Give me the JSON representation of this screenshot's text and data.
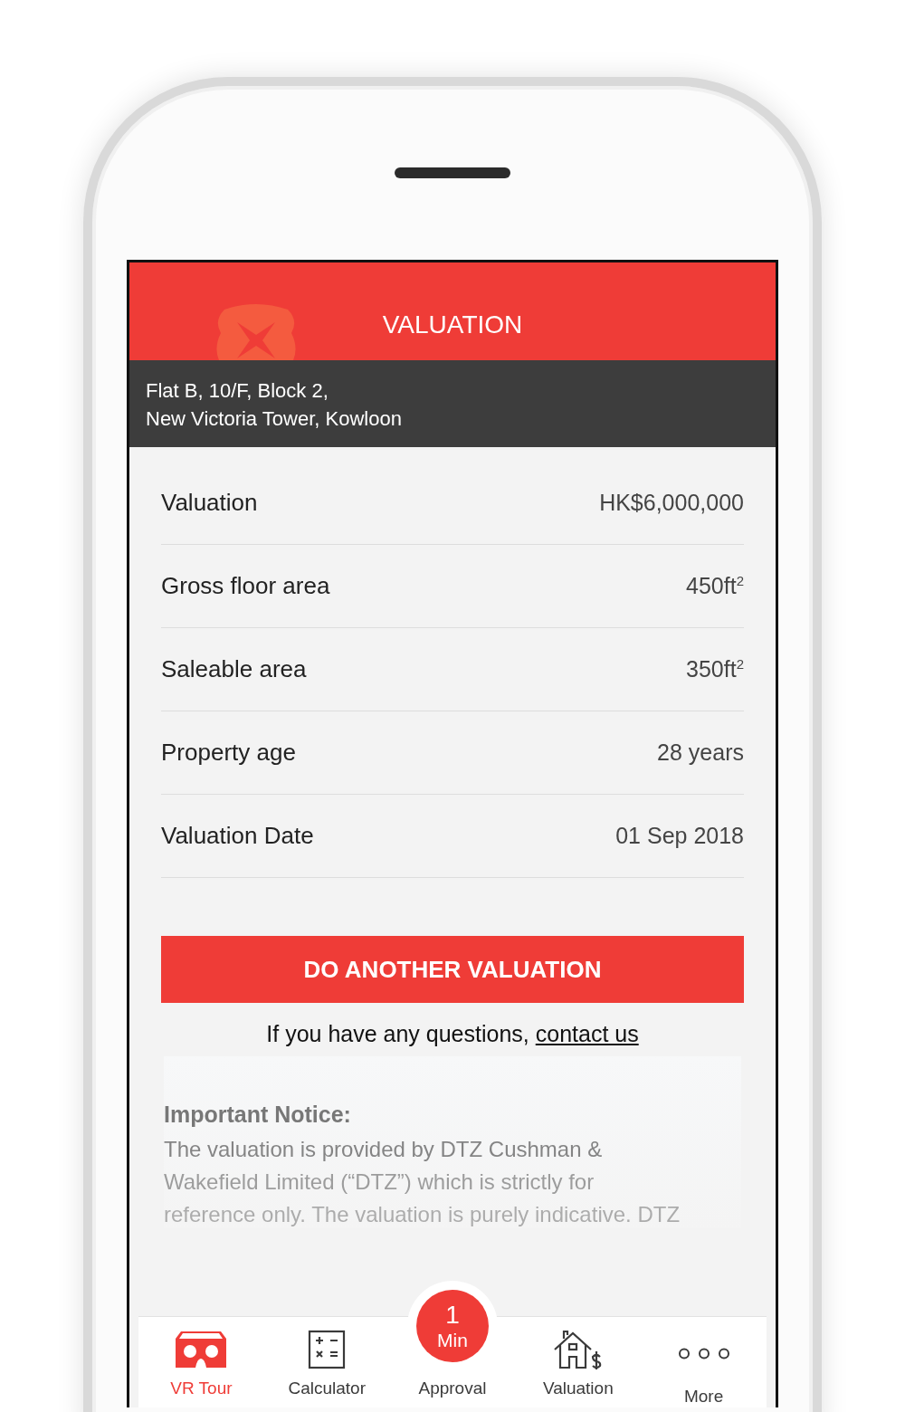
{
  "header": {
    "title": "VALUATION"
  },
  "address": [
    "Flat B, 10/F, Block 2,",
    "New Victoria Tower, Kowloon"
  ],
  "rows": [
    {
      "label": "Valuation",
      "value": "HK$6,000,000"
    },
    {
      "label": "Gross floor area",
      "value": "450ft$^{2}$"
    },
    {
      "label": "Saleable area",
      "value": "350ft$^{2}$"
    },
    {
      "label": "Property age",
      "value": "28 years"
    },
    {
      "label": "Valuation Date",
      "value": "01 Sep 2018"
    }
  ],
  "button": "DO ANOTHER VALUATION",
  "contact": {
    "text": "If you have any questions,",
    "link": "contact us"
  },
  "notice": {
    "title": "Important Notice:",
    "lines": [
      "The valuation is provided by DTZ Cushman &",
      "Wakefield Limited (“DTZ”) which is strictly for",
      "reference only. The valuation is purely indicative. DTZ"
    ]
  },
  "nav": {
    "items": [
      {
        "kind": "vr",
        "label": "VR Tour",
        "selected": true
      },
      {
        "kind": "calculator",
        "label": "Calculator",
        "selected": false
      },
      {
        "kind": "badge",
        "label": "Approval",
        "badge_number": "1",
        "badge_unit": "Min",
        "selected": false
      },
      {
        "kind": "house",
        "label": "Valuation",
        "selected": false
      },
      {
        "kind": "more",
        "label": "More",
        "selected": false
      }
    ]
  }
}
